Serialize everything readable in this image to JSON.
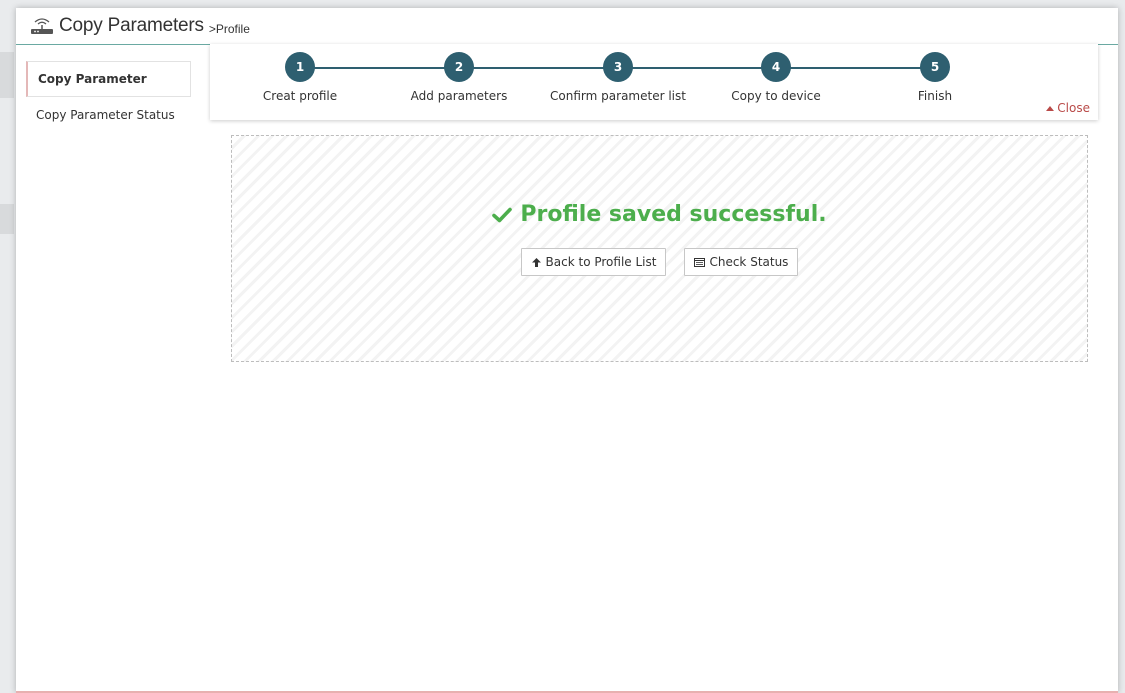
{
  "window": {
    "title": "Copy Parameters",
    "breadcrumb": ">Profile",
    "title_icon": "router-icon"
  },
  "sidebar": {
    "items": [
      {
        "label": "Copy Parameter",
        "active": true
      },
      {
        "label": "Copy Parameter Status",
        "active": false
      }
    ]
  },
  "wizard": {
    "steps": [
      {
        "number": "1",
        "label": "Creat profile"
      },
      {
        "number": "2",
        "label": "Add parameters"
      },
      {
        "number": "3",
        "label": "Confirm parameter list"
      },
      {
        "number": "4",
        "label": "Copy to device"
      },
      {
        "number": "5",
        "label": "Finish"
      }
    ],
    "close_label": "Close",
    "step_color": "#2e5f70"
  },
  "result": {
    "message": "Profile saved successful.",
    "success_color": "#4cae4c",
    "back_button": "Back to Profile List",
    "back_icon": "arrow-up-icon",
    "status_button": "Check Status",
    "status_icon": "list-icon"
  }
}
